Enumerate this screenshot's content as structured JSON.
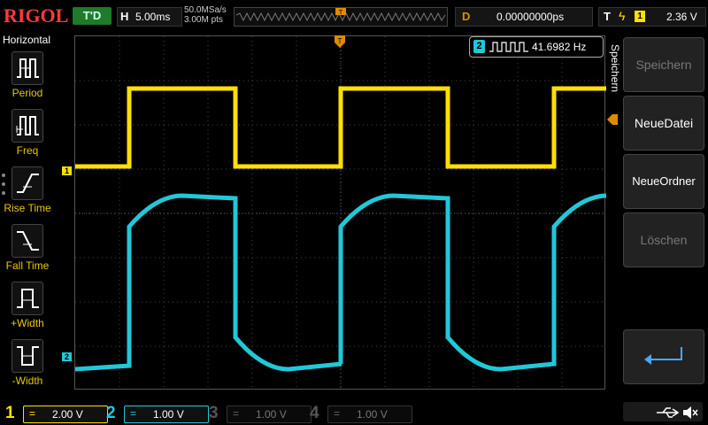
{
  "brand": "RIGOL",
  "top": {
    "trigger_status": "T'D",
    "horizontal": {
      "tag": "H",
      "value": "5.00ms"
    },
    "sample": {
      "rate": "50.0MSa/s",
      "points": "3.00M pts"
    },
    "delay": {
      "tag": "D",
      "value": "0.00000000ps"
    },
    "trigger": {
      "tag": "T",
      "edge": "ϟ",
      "source": "1",
      "level": "2.36 V"
    }
  },
  "left_menu": {
    "title": "Horizontal",
    "items": [
      {
        "label": "Period",
        "icon": "period-icon"
      },
      {
        "label": "Freq",
        "icon": "freq-icon"
      },
      {
        "label": "Rise Time",
        "icon": "rise-time-icon"
      },
      {
        "label": "Fall Time",
        "icon": "fall-time-icon"
      },
      {
        "label": "+Width",
        "icon": "positive-width-icon"
      },
      {
        "label": "-Width",
        "icon": "negative-width-icon"
      }
    ]
  },
  "right_menu": {
    "title": "Speichern",
    "buttons": [
      {
        "label": "Speichern",
        "state": "disabled"
      },
      {
        "label": "NeueDatei",
        "state": "enabled"
      },
      {
        "label": "NeueOrdner",
        "state": "enabled"
      },
      {
        "label": "Löschen",
        "state": "disabled"
      },
      {
        "label": "",
        "icon": "return-arrow-icon",
        "state": "enabled"
      }
    ]
  },
  "measurement": {
    "channel": "2",
    "value": "41.6982 Hz"
  },
  "channels": [
    {
      "num": "1",
      "coupling": "=",
      "scale": "2.00 V",
      "color": "#ffe000",
      "active": true
    },
    {
      "num": "2",
      "coupling": "=",
      "scale": "1.00 V",
      "color": "#21c8d8",
      "active": true
    },
    {
      "num": "3",
      "coupling": "=",
      "scale": "1.00 V",
      "color": "#c040c0",
      "active": false
    },
    {
      "num": "4",
      "coupling": "=",
      "scale": "1.00 V",
      "color": "#3060ff",
      "active": false
    }
  ],
  "colors": {
    "ch1": "#ffe000",
    "ch2": "#21c8d8",
    "grid": "#555555",
    "trigger_marker": "#e08a00"
  }
}
